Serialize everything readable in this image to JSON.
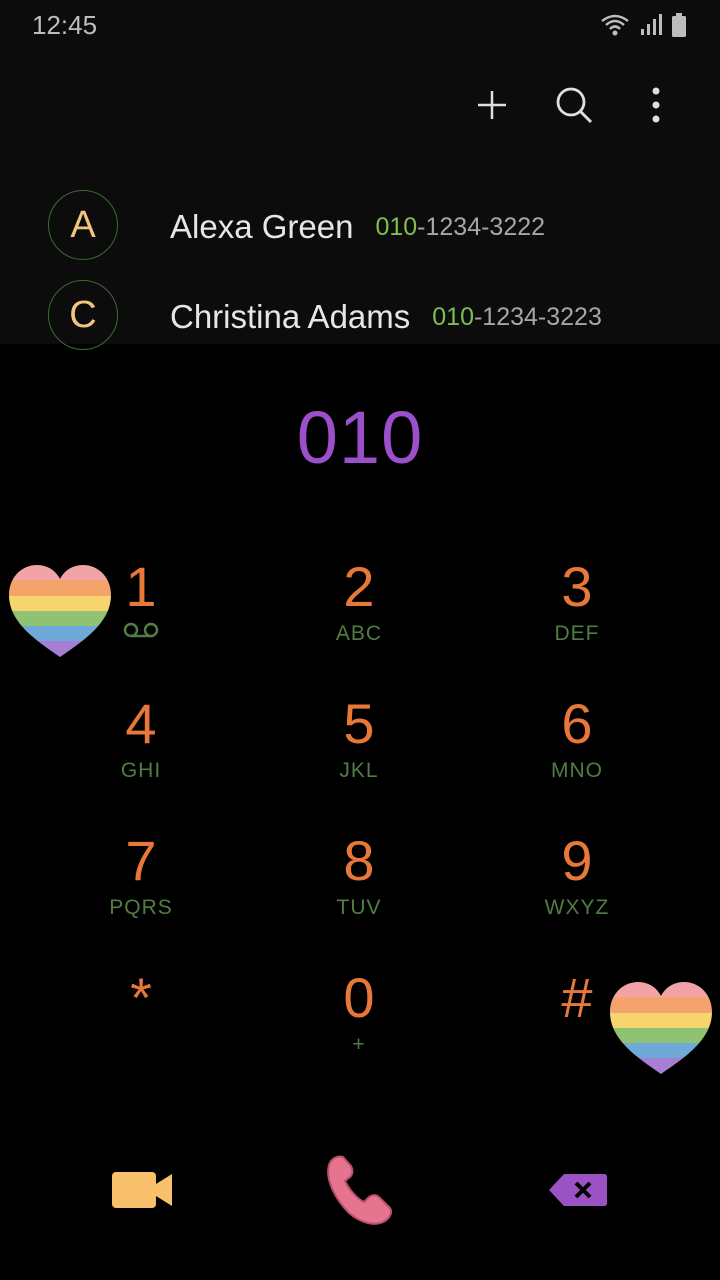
{
  "status_bar": {
    "time": "12:45",
    "icons": [
      "wifi-icon",
      "signal-icon",
      "battery-icon"
    ]
  },
  "action_bar": {
    "icons": [
      "add-icon",
      "search-icon",
      "more-icon"
    ]
  },
  "contacts": [
    {
      "initial": "A",
      "name": "Alexa Green",
      "number_match": "010",
      "number_rest": "-1234-3222"
    },
    {
      "initial": "C",
      "name": "Christina Adams",
      "number_match": "010",
      "number_rest": "-1234-3223"
    }
  ],
  "dialer": {
    "display": "010",
    "keys": [
      {
        "digit": "1",
        "sub": ""
      },
      {
        "digit": "2",
        "sub": "ABC"
      },
      {
        "digit": "3",
        "sub": "DEF"
      },
      {
        "digit": "4",
        "sub": "GHI"
      },
      {
        "digit": "5",
        "sub": "JKL"
      },
      {
        "digit": "6",
        "sub": "MNO"
      },
      {
        "digit": "7",
        "sub": "PQRS"
      },
      {
        "digit": "8",
        "sub": "TUV"
      },
      {
        "digit": "9",
        "sub": "WXYZ"
      },
      {
        "digit": "*",
        "sub": ""
      },
      {
        "digit": "0",
        "sub": "+"
      },
      {
        "digit": "#",
        "sub": ""
      }
    ]
  },
  "bottom_bar": {
    "icons": [
      "video-call-icon",
      "phone-call-icon",
      "backspace-icon"
    ]
  },
  "colors": {
    "background": "#000000",
    "top_panel": "#0c0c0c",
    "digit": "#e8773a",
    "sub_letters": "#4f7d43",
    "dial_display": "#9c4fcb",
    "number_match": "#7fbe4e",
    "avatar_letter": "#f2c57d",
    "video_icon": "#f9c16c",
    "call_icon": "#e7748f",
    "backspace_icon": "#9a52c4"
  }
}
